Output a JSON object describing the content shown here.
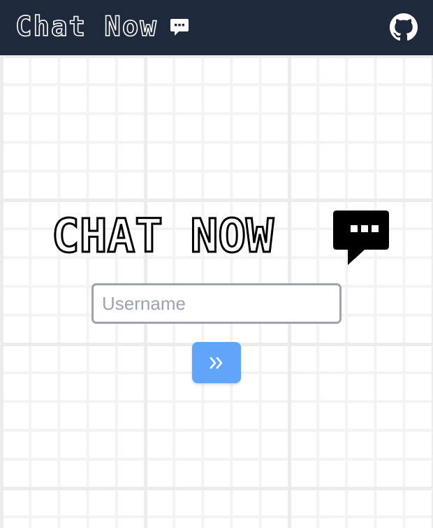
{
  "navbar": {
    "title": "Chat Now",
    "chat_icon": "chat-bubble-icon",
    "github_icon": "github-icon",
    "background_color": "#1e293b"
  },
  "hero": {
    "title": "CHAT NOW",
    "icon": "chat-bubble-icon"
  },
  "login": {
    "username_placeholder": "Username",
    "username_value": "",
    "submit_icon": "double-chevron-right-icon",
    "submit_color": "#60a5fa"
  }
}
